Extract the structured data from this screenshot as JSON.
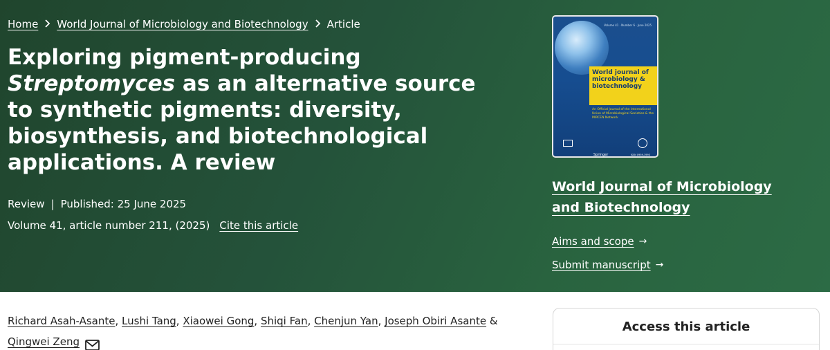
{
  "breadcrumb": {
    "home": "Home",
    "journal": "World Journal of Microbiology and Biotechnology",
    "current": "Article",
    "separator": ">"
  },
  "article": {
    "title_line1": "Exploring pigment-producing",
    "title_genus": "Streptomyces",
    "title_rest": " as an alternative source to synthetic pigments: diversity, biosynthesis, and biotechnological applications. A review",
    "type": "Review",
    "published": "Published: 25 June 2025",
    "volume_info": "Volume 41, article number 211, (2025)",
    "cite_label": "Cite this article"
  },
  "sidebar": {
    "journal_name": "World Journal of Microbiology and Biotechnology",
    "aims_label": "Aims and scope",
    "submit_label": "Submit manuscript",
    "arrow": "→"
  },
  "cover": {
    "issue_line": "Volume 41 · Number 6 · June 2025",
    "journal_title": "World journal of microbiology & biotechnology",
    "subtitle": "An Official Journal of the International Union of Microbiological Societies & the MIRCEN Network",
    "iums": "IUMS",
    "springer": "Springer",
    "issn": "ISSN 0959-3993"
  },
  "authors": {
    "names": [
      "Richard Asah-Asante",
      "Lushi Tang",
      "Xiaowei Gong",
      "Shiqi Fan",
      "Chenjun Yan",
      "Joseph Obiri Asante",
      "Qingwei Zeng"
    ],
    "conjunction": "&"
  },
  "access": {
    "title": "Access this article"
  },
  "colors": {
    "hero_start": "#20452d",
    "hero_end": "#2c6b45",
    "cover_band": "#f2d21b"
  }
}
